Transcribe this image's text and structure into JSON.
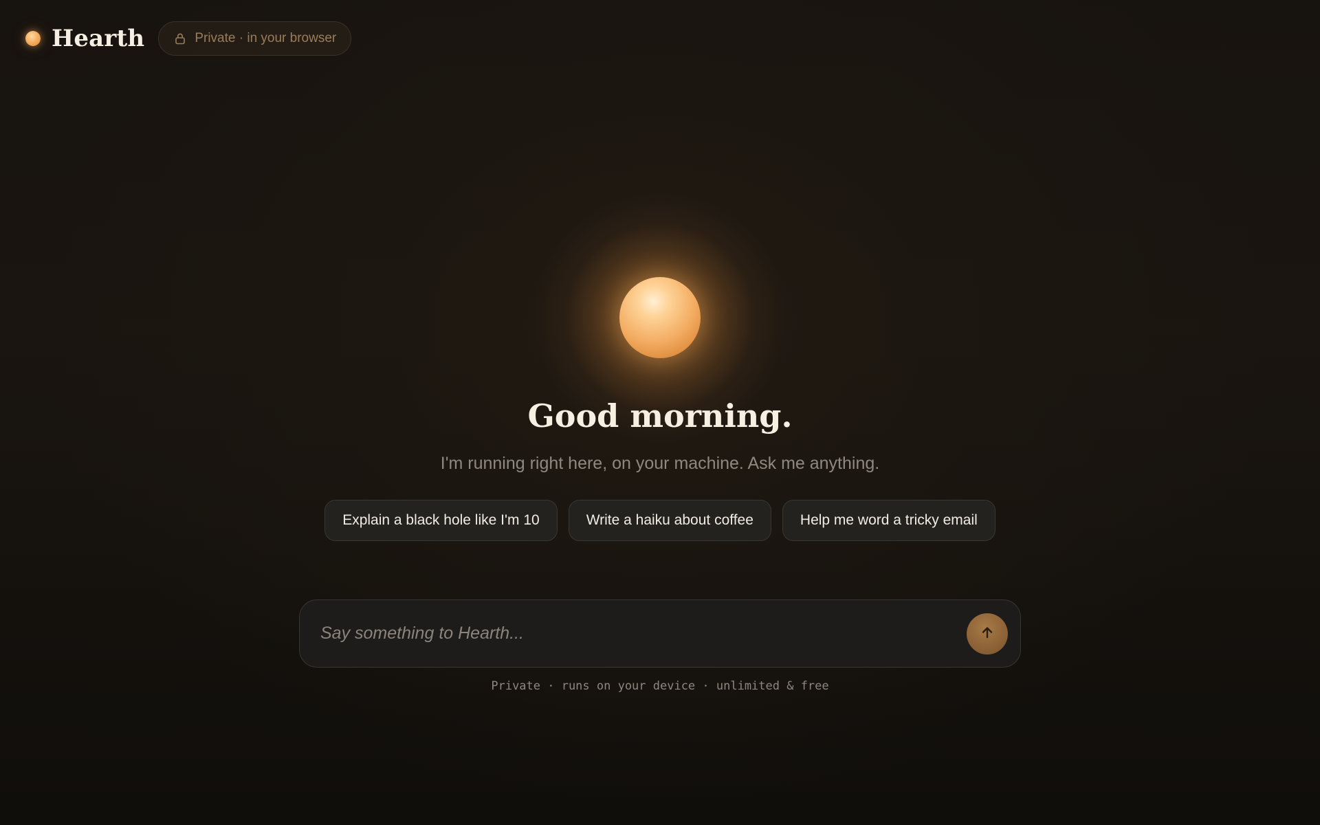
{
  "header": {
    "brand": "Hearth",
    "privacy_badge": "Private · in your browser",
    "icons": {
      "logo": "hearth-orb-icon",
      "lock": "lock-icon"
    }
  },
  "hero": {
    "greeting": "Good morning.",
    "subtitle": "I'm running right here, on your machine. Ask me anything.",
    "icon": "glowing-orb-icon"
  },
  "suggestions": [
    {
      "label": "Explain a black hole like I'm 10"
    },
    {
      "label": "Write a haiku about coffee"
    },
    {
      "label": "Help me word a tricky email"
    }
  ],
  "composer": {
    "placeholder": "Say something to Hearth...",
    "value": "",
    "send_icon": "arrow-up-icon"
  },
  "footer": {
    "note": "Private · runs on your device · unlimited & free"
  },
  "colors": {
    "accent": "#f3ad63",
    "background": "#17130f",
    "badge_text": "#9a7d57",
    "send_button": "#8c6236"
  }
}
